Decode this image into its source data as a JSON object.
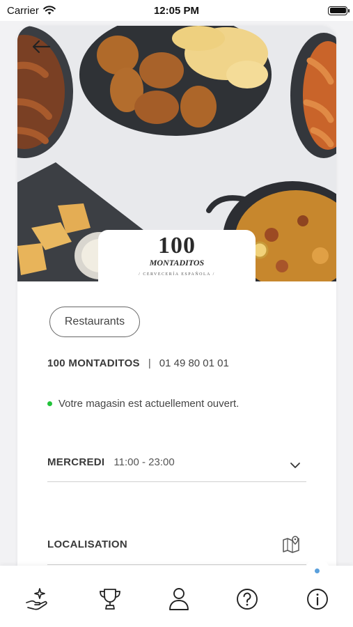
{
  "status_bar": {
    "carrier": "Carrier",
    "time": "12:05 PM"
  },
  "hero": {
    "logo_number": "100",
    "logo_word": "MONTADITOS",
    "logo_tagline": "/ CERVECERÍA ESPAÑOLA /"
  },
  "store": {
    "category": "Restaurants",
    "name": "100 MONTADITOS",
    "separator": "|",
    "phone": "01 49 80 01 01",
    "open_status": "Votre magasin est actuellement ouvert.",
    "open_color": "#22c33a",
    "hours": {
      "day": "MERCREDI",
      "time": "11:00 - 23:00"
    },
    "location_title": "LOCALISATION"
  },
  "tab_bar": {
    "tabs": [
      "offers-hand-sparkle-icon",
      "trophy-icon",
      "profile-icon",
      "help-question-icon",
      "info-icon"
    ],
    "active_index": 4,
    "indicator_color": "#5aa0dc"
  }
}
